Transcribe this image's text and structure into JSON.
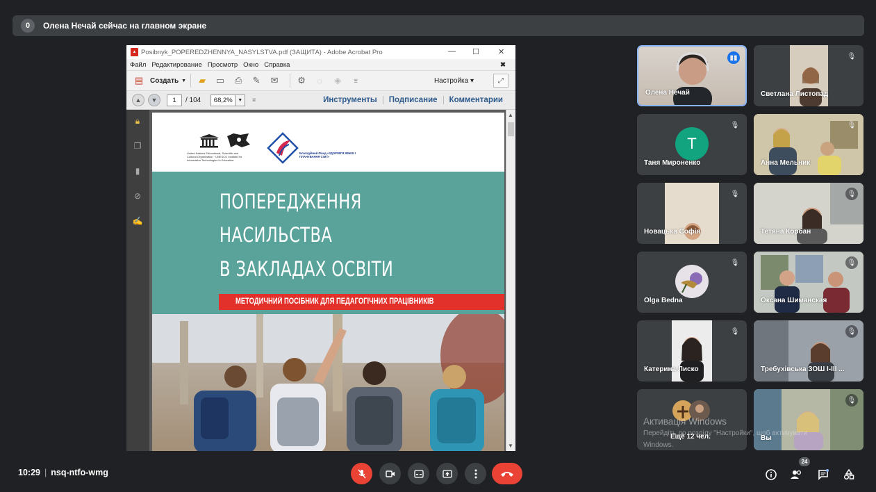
{
  "banner": {
    "badge": "0",
    "text": "Олена Нечай сейчас на главном экране"
  },
  "acrobat": {
    "title": "Posibnyk_POPEREDZHENNYA_NASYLSTVA.pdf (ЗАЩИТА) - Adobe Acrobat Pro",
    "menu": [
      "Файл",
      "Редактирование",
      "Просмотр",
      "Окно",
      "Справка"
    ],
    "create_label": "Создать",
    "customize_label": "Настройка",
    "page_current": "1",
    "page_total": "/ 104",
    "zoom": "68,2%",
    "panels": [
      "Инструменты",
      "Подписание",
      "Комментарии"
    ]
  },
  "pdf": {
    "headline": [
      "ПОПЕРЕДЖЕННЯ",
      "НАСИЛЬСТВА",
      "В ЗАКЛАДАХ ОСВІТИ"
    ],
    "subtitle": "МЕТОДИЧНИЙ ПОСІБНИК ДЛЯ ПЕДАГОГІЧНИХ ПРАЦІВНИКІВ",
    "unesco_text": "United Nations Educational, Scientific and Cultural Organization · UNESCO Institute for Information Technologies in Education",
    "fund_text": "Благодійний Фонд «ЗДОРОВ'Я ЖІНКИ І ПЛАНУВАННЯ СІМ'Ї»"
  },
  "participants": [
    {
      "name": "Олена Нечай",
      "speaking": true
    },
    {
      "name": "Светлана Листопад"
    },
    {
      "name": "Таня Мироненко",
      "initial": "T"
    },
    {
      "name": "Анна Мельник"
    },
    {
      "name": "Новацька Софія"
    },
    {
      "name": "Тетяна Корбан"
    },
    {
      "name": "Olga Bedna"
    },
    {
      "name": "Оксана Шиманская"
    },
    {
      "name": "Катерина Лиско"
    },
    {
      "name": "Требухівська ЗОШ І-ІІІ ..."
    },
    {
      "name": "Ещё 12 чел."
    },
    {
      "name": "Вы"
    }
  ],
  "watermark": {
    "line1": "Активація Windows",
    "line2": "Перейдіть до розділу \"Настройки\", щоб активувати",
    "line3": "Windows."
  },
  "bottom": {
    "time": "10:29",
    "meeting_code": "nsq-ntfo-wmg",
    "participant_count": "24"
  },
  "colors": {
    "accent_blue": "#8ab4f8",
    "red": "#ea4335",
    "teal": "#5aa39b"
  }
}
